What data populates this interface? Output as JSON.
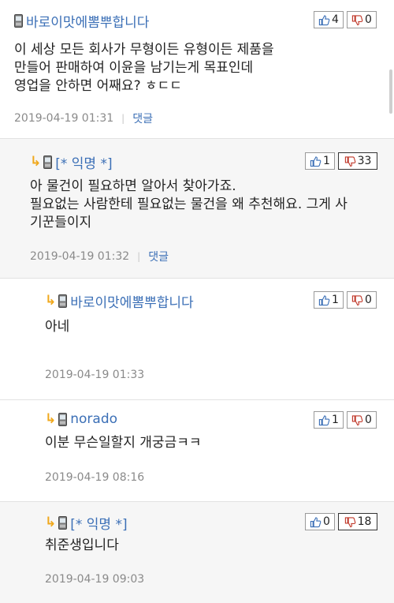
{
  "comments": [
    {
      "author": "바로이맛에뽐뿌합니다",
      "up": "4",
      "down": "0",
      "lines": [
        "이 세상 모든 회사가 무형이든 유형이든 제품을",
        "만들어 판매하여 이윤을 남기는게 목표인데",
        "영업을 안하면 어째요? ㅎㄷㄷ"
      ],
      "date": "2019-04-19 01:31",
      "reply_label": "댓글"
    },
    {
      "author": "[* 익명 *]",
      "up": "1",
      "down": "33",
      "lines": [
        "아 물건이 필요하면 알아서 찾아가죠.",
        "필요없는 사람한테 필요없는 물건을 왜 추천해요. 그게 사",
        "기꾼들이지"
      ],
      "date": "2019-04-19 01:32",
      "reply_label": "댓글"
    },
    {
      "author": "바로이맛에뽐뿌합니다",
      "up": "1",
      "down": "0",
      "lines": [
        "아네"
      ],
      "date": "2019-04-19 01:33"
    },
    {
      "author": "norado",
      "up": "1",
      "down": "0",
      "lines": [
        "이분 무슨일할지 개궁금ㅋㅋ"
      ],
      "date": "2019-04-19 08:16"
    },
    {
      "author": "[* 익명 *]",
      "up": "0",
      "down": "18",
      "lines": [
        "취준생입니다"
      ],
      "date": "2019-04-19 09:03"
    }
  ],
  "icons": {
    "phone": "mobile-phone-icon",
    "reply_arrow": "reply-arrow-icon",
    "thumbs_up": "thumbs-up-icon",
    "thumbs_down": "thumbs-down-icon"
  },
  "colors": {
    "author": "#3b6fb6",
    "reply_arrow": "#f0a81c",
    "meta": "#8a8a8a",
    "alt_background": "#f6f6f6"
  }
}
